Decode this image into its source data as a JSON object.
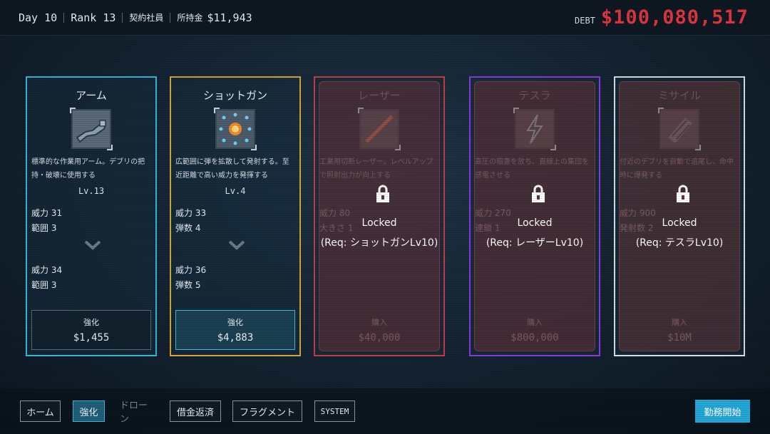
{
  "topbar": {
    "day": "Day 10",
    "rank": "Rank 13",
    "employment": "契約社員",
    "money_label": "所持金",
    "money_value": "$11,943",
    "debt_label": "DEBT",
    "debt_value": "$100,080,517"
  },
  "cards": [
    {
      "title": "アーム",
      "icon": "arm-icon",
      "desc": "標準的な作業用アーム。デブリの把持・破壊に使用する",
      "level": "Lv.13",
      "current_stats": [
        "威力 31",
        "範囲 3"
      ],
      "next_stats": [
        "威力 34",
        "範囲 3"
      ],
      "buy_label": "強化",
      "price": "$1,455"
    },
    {
      "title": "ショットガン",
      "icon": "shotgun-icon",
      "desc": "広範囲に弾を拡散して発射する。至近距離で高い威力を発揮する",
      "level": "Lv.4",
      "current_stats": [
        "威力 33",
        "弾数 4"
      ],
      "next_stats": [
        "威力 36",
        "弾数 5"
      ],
      "buy_label": "強化",
      "price": "$4,883"
    },
    {
      "title": "レーザー",
      "icon": "laser-icon",
      "desc": "工業用切断レーザー。レベルアップで照射出力が向上する",
      "stats": [
        "威力 80",
        "大きさ 1"
      ],
      "locked_text": "Locked",
      "requirement": "(Req: ショットガンLv10)",
      "buy_label": "購入",
      "price": "$40,000"
    },
    {
      "title": "テスラ",
      "icon": "lightning-icon",
      "desc": "高圧の稲妻を放ち、直線上の集団を感電させる",
      "stats": [
        "威力 270",
        "連鎖 1"
      ],
      "locked_text": "Locked",
      "requirement": "(Req: レーザーLv10)",
      "buy_label": "購入",
      "price": "$800,000"
    },
    {
      "title": "ミサイル",
      "icon": "missile-icon",
      "desc": "付近のデブリを自動で追尾し、命中時に爆発する",
      "stats": [
        "威力 900",
        "発射数 2"
      ],
      "locked_text": "Locked",
      "requirement": "(Req: テスラLv10)",
      "buy_label": "購入",
      "price": "$10M"
    }
  ],
  "nav": {
    "home": "ホーム",
    "upgrade": "強化",
    "drone": "ドローン",
    "repay": "借金返済",
    "fragment": "フラグメント",
    "system": "SYSTEM",
    "start": "勤務開始"
  },
  "colors": {
    "arm_border": "#35b6d6",
    "shotgun_border": "#d6a43a",
    "laser_border": "#c83a44",
    "tesla_border": "#8a3ad8",
    "missile_border": "#d8dde2",
    "debt": "#e0343e",
    "accent": "#23a8d8"
  }
}
